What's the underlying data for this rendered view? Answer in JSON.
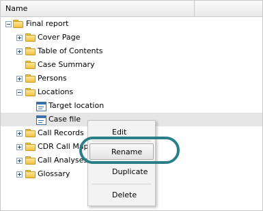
{
  "header": {
    "column_name": "Name"
  },
  "tree": [
    {
      "label": "Final report",
      "type": "folder",
      "expander": "minus"
    },
    {
      "label": "Cover Page",
      "type": "folder",
      "expander": "plus"
    },
    {
      "label": "Table of Contents",
      "type": "folder",
      "expander": "plus"
    },
    {
      "label": "Case Summary",
      "type": "folder",
      "expander": "none"
    },
    {
      "label": "Persons",
      "type": "folder",
      "expander": "plus"
    },
    {
      "label": "Locations",
      "type": "folder",
      "expander": "minus"
    },
    {
      "label": "Target location",
      "type": "document",
      "expander": "none"
    },
    {
      "label": "Case file",
      "type": "document",
      "expander": "none",
      "selected": true
    },
    {
      "label": "Call Records",
      "type": "folder",
      "expander": "plus"
    },
    {
      "label": "CDR Call Map",
      "type": "folder",
      "expander": "plus"
    },
    {
      "label": "Call Analyses",
      "type": "folder",
      "expander": "plus"
    },
    {
      "label": "Glossary",
      "type": "folder",
      "expander": "plus"
    }
  ],
  "context_menu": {
    "edit": "Edit",
    "rename": "Rename",
    "duplicate": "Duplicate",
    "delete": "Delete"
  },
  "colors": {
    "highlight_ring": "#2a7f86",
    "selected_row": "#e6e6e6"
  }
}
